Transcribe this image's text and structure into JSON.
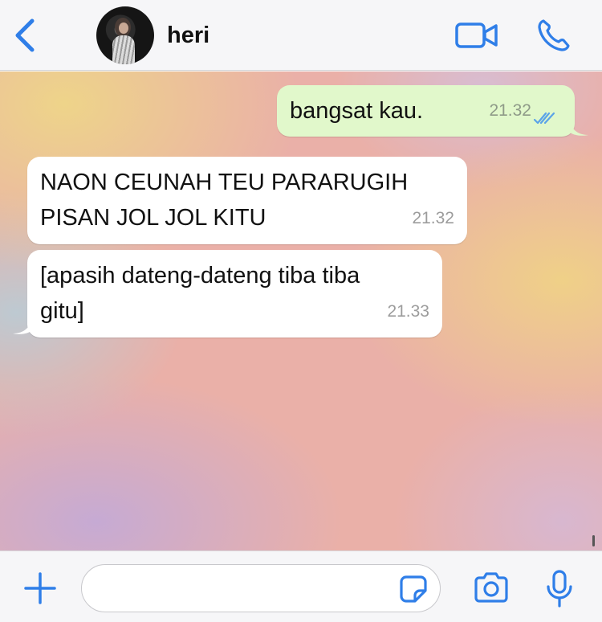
{
  "header": {
    "contact_name": "heri",
    "back_icon": "chevron-left-icon",
    "video_icon": "video-camera-icon",
    "call_icon": "phone-icon",
    "accent_color": "#2f7ee8"
  },
  "messages": [
    {
      "direction": "outgoing",
      "text": "bangsat kau.",
      "time": "21.32",
      "status": "read"
    },
    {
      "direction": "incoming",
      "text": "NAON CEUNAH TEU PARARUGIH\nPISAN JOL JOL KITU",
      "time": "21.32"
    },
    {
      "direction": "incoming",
      "text": "[apasih dateng-dateng tiba tiba\ngitu]",
      "time": "21.33"
    }
  ],
  "composer": {
    "input_value": "",
    "plus_icon": "plus-icon",
    "sticker_icon": "sticker-icon",
    "camera_icon": "camera-icon",
    "mic_icon": "microphone-icon"
  },
  "colors": {
    "outgoing_bubble": "#e1f8cb",
    "incoming_bubble": "#ffffff",
    "read_ticks": "#5aa3e8"
  }
}
